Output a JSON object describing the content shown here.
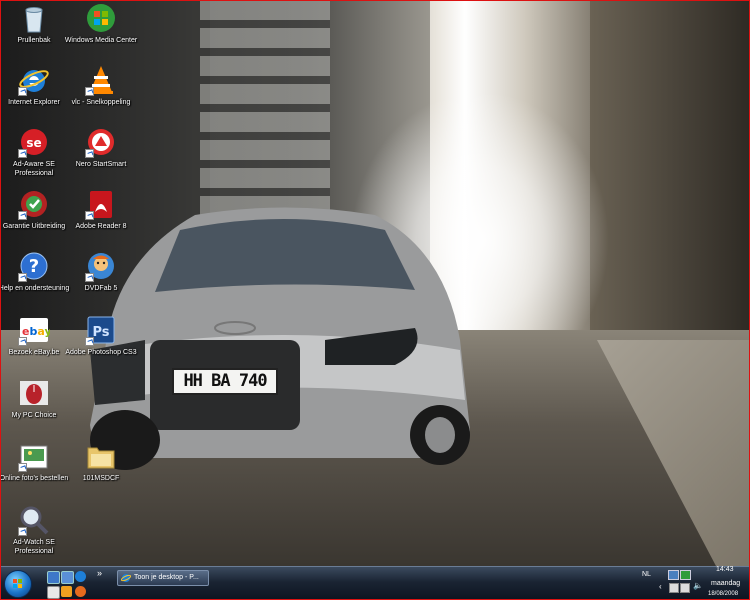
{
  "desktop_icons": [
    {
      "label": "Prullenbak",
      "icon": "recycle-bin-icon"
    },
    {
      "label": "Windows Media Center",
      "icon": "windows-media-center-icon"
    },
    {
      "label": "Internet Explorer",
      "icon": "internet-explorer-icon"
    },
    {
      "label": "vlc - Snelkoppeling",
      "icon": "vlc-icon"
    },
    {
      "label": "Ad-Aware SE Professional",
      "icon": "ad-aware-icon"
    },
    {
      "label": "Nero StartSmart",
      "icon": "nero-icon"
    },
    {
      "label": "Garantie Uitbreiding",
      "icon": "garantie-icon"
    },
    {
      "label": "Adobe Reader 8",
      "icon": "adobe-reader-icon"
    },
    {
      "label": "Help en ondersteuning",
      "icon": "help-icon"
    },
    {
      "label": "DVDFab 5",
      "icon": "dvdfab-icon"
    },
    {
      "label": "Bezoek eBay.be",
      "icon": "ebay-icon"
    },
    {
      "label": "Adobe Photoshop CS3",
      "icon": "photoshop-icon"
    },
    {
      "label": "My PC Choice",
      "icon": "mouse-icon"
    },
    {
      "label": "Online foto's bestellen",
      "icon": "photo-order-icon"
    },
    {
      "label": "101MSDCF",
      "icon": "folder-icon"
    },
    {
      "label": "Ad-Watch SE Professional",
      "icon": "ad-watch-icon"
    }
  ],
  "wallpaper": {
    "license_plate": "HH BA 740"
  },
  "taskbar": {
    "task_button": "Toon je desktop - P...",
    "quicklaunch_chevron": "»",
    "tray_language": "NL",
    "clock_time": "14:43",
    "clock_day": "maandag",
    "clock_date": "18/08/2008"
  },
  "colors": {
    "taskbar": "#1a2433",
    "start_orb": "#1b74c9",
    "frame": "#dd1111"
  }
}
